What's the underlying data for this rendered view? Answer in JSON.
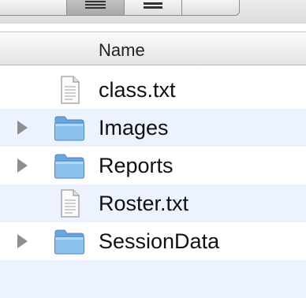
{
  "toolbar": {
    "view_buttons": [
      {
        "name": "icon-view-icon"
      },
      {
        "name": "list-view-icon"
      },
      {
        "name": "column-view-icon"
      },
      {
        "name": "cover-flow-view-icon"
      }
    ],
    "selected_view": "list"
  },
  "list": {
    "column_header": "Name",
    "items": [
      {
        "label": "class.txt",
        "type": "file",
        "expandable": false
      },
      {
        "label": "Images",
        "type": "folder",
        "expandable": true
      },
      {
        "label": "Reports",
        "type": "folder",
        "expandable": true
      },
      {
        "label": "Roster.txt",
        "type": "file",
        "expandable": false
      },
      {
        "label": "SessionData",
        "type": "folder",
        "expandable": true
      }
    ]
  },
  "colors": {
    "alt_row": "#edf3fe",
    "folder_blue": "#7fb6e6",
    "disclosure": "#8e8e8e"
  }
}
